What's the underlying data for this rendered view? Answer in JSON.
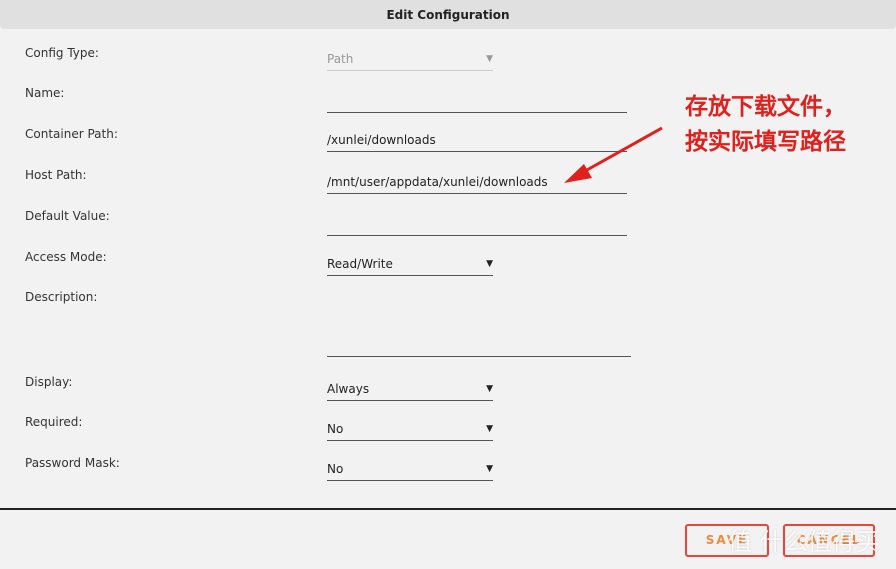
{
  "dialog": {
    "title": "Edit Configuration"
  },
  "fields": [
    {
      "label": "Config Type:",
      "value": "Path",
      "type": "select",
      "disabled": true
    },
    {
      "label": "Name:",
      "value": "",
      "type": "text"
    },
    {
      "label": "Container Path:",
      "value": "/xunlei/downloads",
      "type": "text"
    },
    {
      "label": "Host Path:",
      "value": "/mnt/user/appdata/xunlei/downloads",
      "type": "text"
    },
    {
      "label": "Default Value:",
      "value": "",
      "type": "text"
    },
    {
      "label": "Access Mode:",
      "value": "Read/Write",
      "type": "select"
    },
    {
      "label": "Description:",
      "value": "",
      "type": "textarea"
    },
    {
      "label": "Display:",
      "value": "Always",
      "type": "select"
    },
    {
      "label": "Required:",
      "value": "No",
      "type": "select"
    },
    {
      "label": "Password Mask:",
      "value": "No",
      "type": "select"
    }
  ],
  "dropdown_arrow": "▼",
  "buttons": {
    "save": "SAVE",
    "cancel": "CANCEL"
  },
  "annotation": {
    "line1": "存放下载文件，",
    "line2": "按实际填写路径",
    "color": "#e0201c"
  },
  "watermark": "值 什么值得买"
}
